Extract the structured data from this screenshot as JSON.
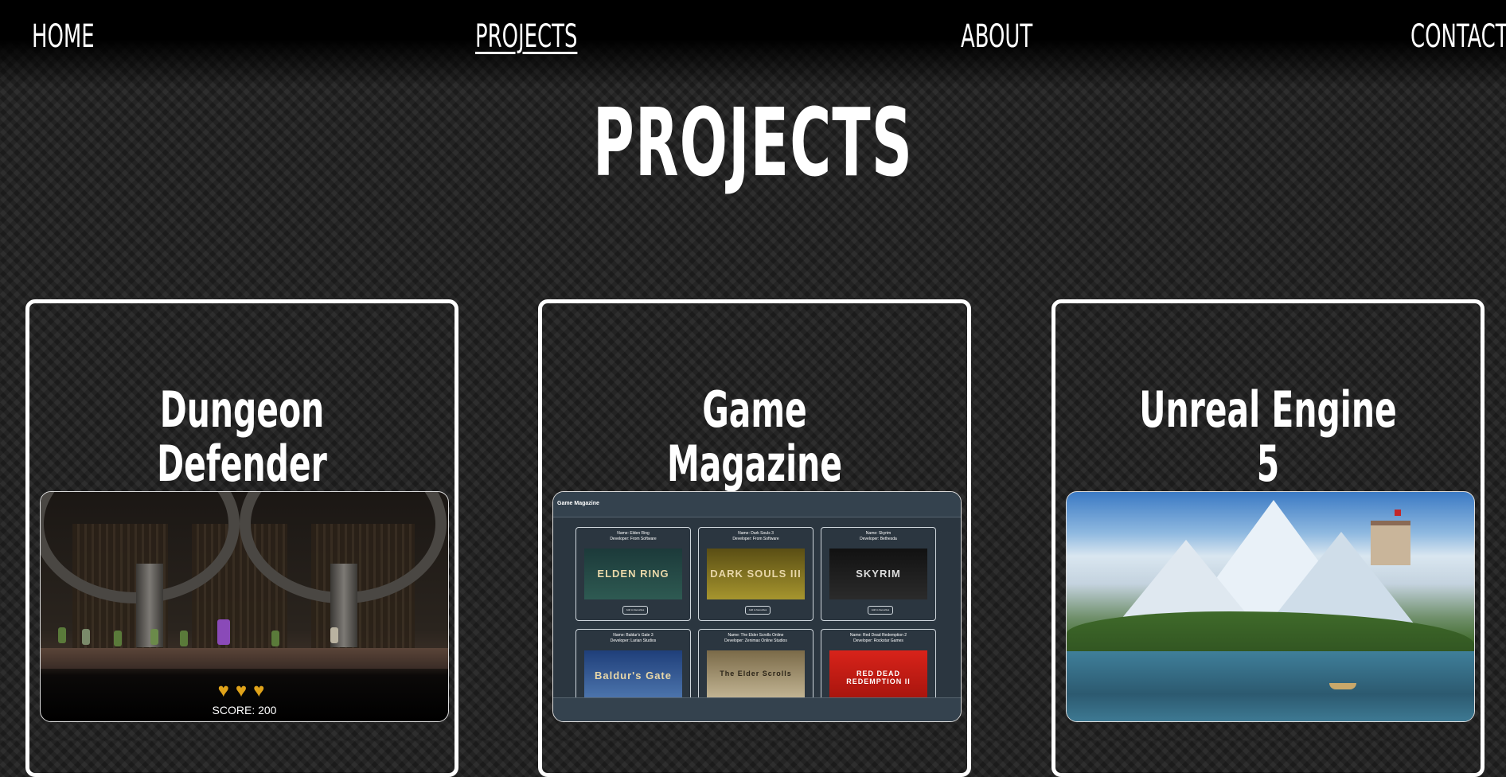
{
  "nav": {
    "home": "HOME",
    "projects": "PROJECTS",
    "about": "ABOUT",
    "contact": "CONTACT",
    "active": "projects"
  },
  "page": {
    "title": "PROJECTS"
  },
  "projects": [
    {
      "title": "Dungeon Defender",
      "thumbnail": {
        "hearts": "♥♥♥",
        "score": "SCORE: 200"
      }
    },
    {
      "title": "Game Magazine",
      "thumbnail": {
        "bar_title": "Game Magazine",
        "cards": [
          {
            "name": "Name: Elden Ring",
            "developer": "Developer: From Software",
            "art": "ELDEN RING",
            "button": "Add to favourites"
          },
          {
            "name": "Name: Dark Souls 3",
            "developer": "Developer: From Software",
            "art": "DARK SOULS III",
            "button": "Add to favourites"
          },
          {
            "name": "Name: Skyrim",
            "developer": "Developer: Bethesda",
            "art": "SKYRIM",
            "button": "Add to favourites"
          },
          {
            "name": "Name: Baldur's Gate 3",
            "developer": "Developer: Larian Studios",
            "art": "Baldur's Gate",
            "button": ""
          },
          {
            "name": "Name: The Elder Scrolls Online",
            "developer": "Developer: Zenimax Online Studios",
            "art": "The Elder Scrolls",
            "button": ""
          },
          {
            "name": "Name: Red Dead Redemption 2",
            "developer": "Developer: Rockstar Games",
            "art": "RED DEAD REDEMPTION II",
            "button": ""
          }
        ]
      }
    },
    {
      "title": "Unreal Engine 5",
      "thumbnail": {}
    }
  ],
  "colors": {
    "background": "#1f1f1f",
    "text": "#ffffff",
    "heart": "#e0a31a"
  }
}
